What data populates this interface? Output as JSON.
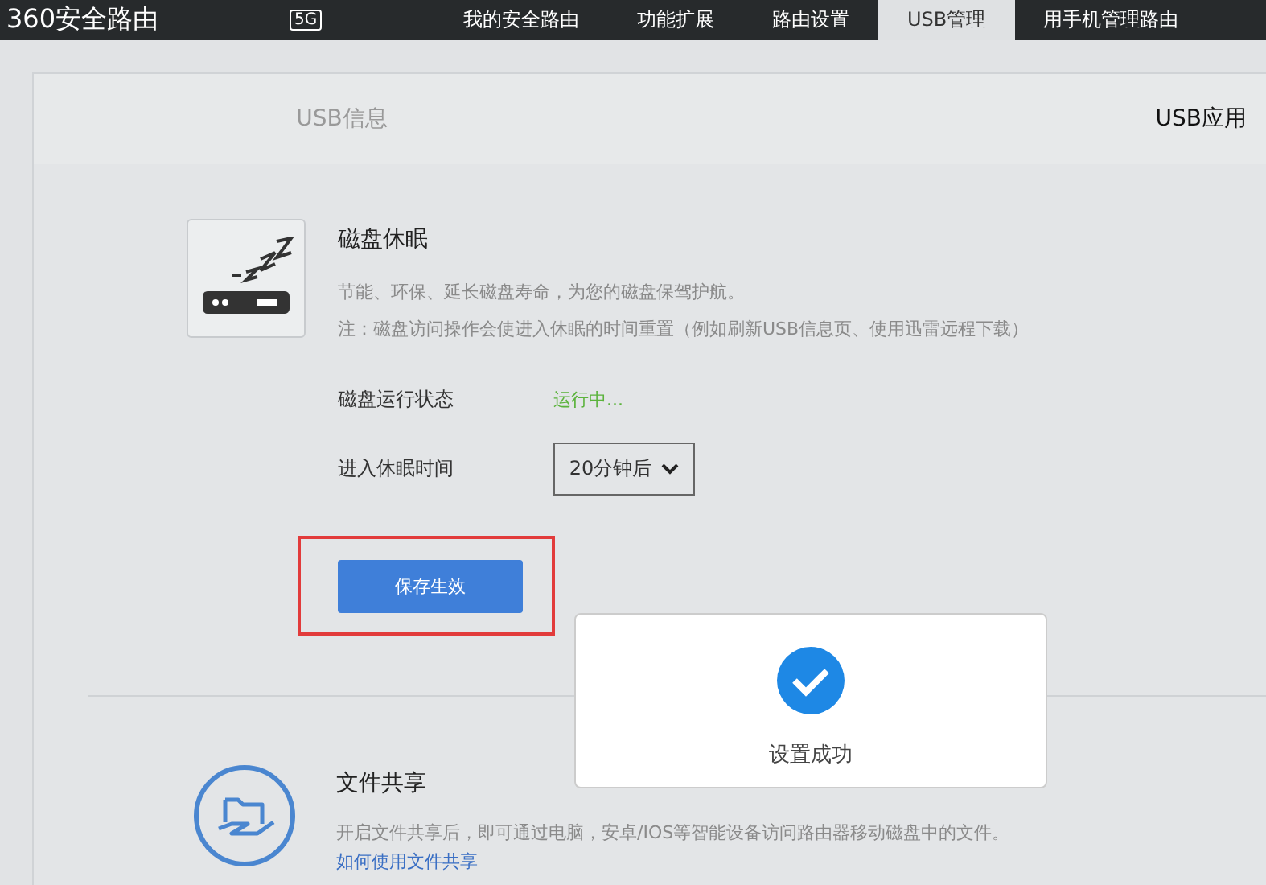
{
  "header": {
    "logo": "360安全路由",
    "badge": "5G",
    "nav": [
      {
        "label": "我的安全路由",
        "selected": false
      },
      {
        "label": "功能扩展",
        "selected": false
      },
      {
        "label": "路由设置",
        "selected": false
      },
      {
        "label": "USB管理",
        "selected": true
      },
      {
        "label": "用手机管理路由",
        "selected": false
      }
    ]
  },
  "tabs": [
    {
      "label": "USB信息",
      "selected": false
    },
    {
      "label": "USB应用",
      "selected": true
    }
  ],
  "sleep": {
    "title": "磁盘休眠",
    "description": "节能、环保、延长磁盘寿命，为您的磁盘保驾护航。",
    "note": "注：磁盘访问操作会使进入休眠的时间重置（例如刷新USB信息页、使用迅雷远程下载）",
    "status_label": "磁盘运行状态",
    "status_value": "运行中...",
    "timer_label": "进入休眠时间",
    "timer_value": "20分钟后",
    "save_button": "保存生效"
  },
  "share": {
    "title": "文件共享",
    "description": "开启文件共享后，即可通过电脑，安卓/IOS等智能设备访问路由器移动磁盘中的文件。",
    "link": "如何使用文件共享"
  },
  "toast": {
    "message": "设置成功"
  }
}
